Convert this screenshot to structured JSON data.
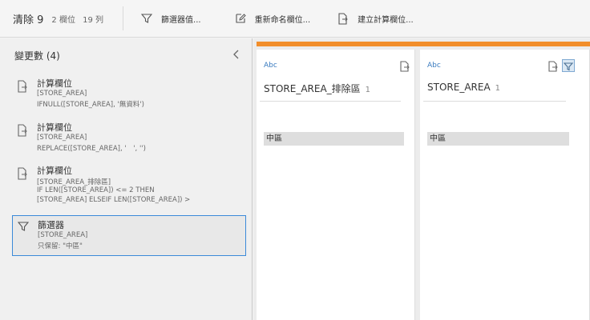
{
  "toolbar": {
    "title": "清除 9",
    "fields": "2 欄位",
    "rows": "19 列",
    "filter_label": "篩選器值...",
    "rename_label": "重新命名欄位...",
    "calc_label": "建立計算欄位..."
  },
  "changes": {
    "header": "變更數 (4)",
    "items": [
      {
        "title": "計算欄位",
        "lines": [
          "[STORE_AREA]",
          "IFNULL([STORE_AREA], '無資料')"
        ],
        "icon": "calculated-field-icon"
      },
      {
        "title": "計算欄位",
        "lines": [
          "[STORE_AREA]",
          "REPLACE([STORE_AREA], '　', '')"
        ],
        "icon": "calculated-field-icon"
      },
      {
        "title": "計算欄位",
        "lines": [
          "[STORE_AREA_排除區]",
          "IF LEN([STORE_AREA]) <= 2 THEN",
          "[STORE_AREA] ELSEIF LEN([STORE_AREA]) >"
        ],
        "icon": "calculated-field-icon"
      },
      {
        "title": "篩選器",
        "lines": [
          "[STORE_AREA]",
          "只保留: \"中區\""
        ],
        "icon": "filter-icon"
      }
    ]
  },
  "columns": [
    {
      "type": "Abc",
      "name": "STORE_AREA_排除區",
      "count": "1",
      "value": "中區"
    },
    {
      "type": "Abc",
      "name": "STORE_AREA",
      "count": "1",
      "value": "中區"
    }
  ],
  "colors": {
    "accent": "#f28e2b",
    "selection": "#3b8ad9",
    "type_label": "#3a7bbf"
  }
}
